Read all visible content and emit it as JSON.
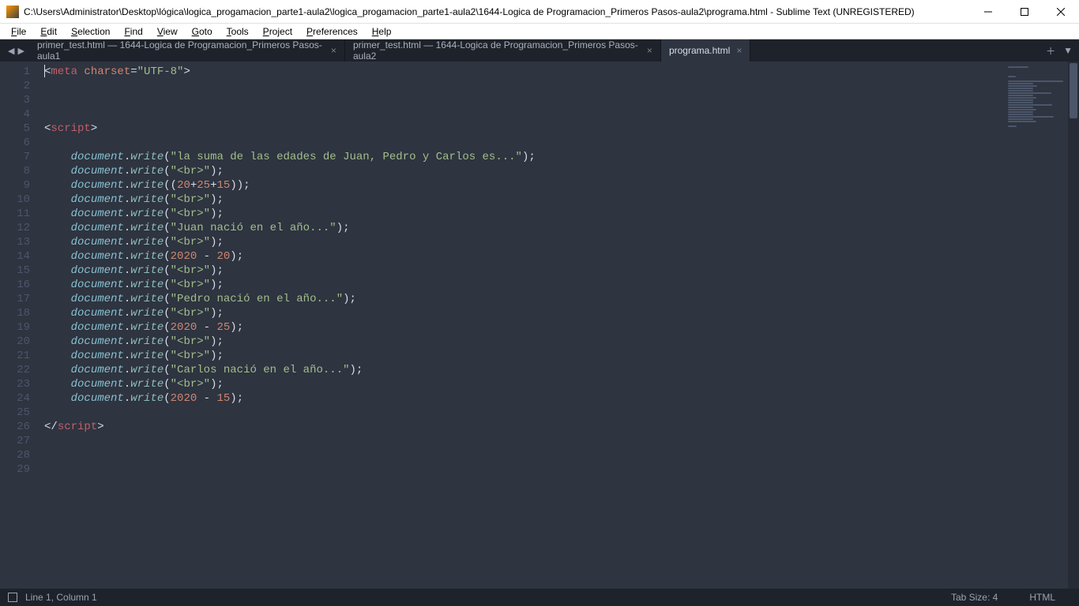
{
  "titlebar": {
    "text": "C:\\Users\\Administrator\\Desktop\\lógica\\logica_progamacion_parte1-aula2\\logica_progamacion_parte1-aula2\\1644-Logica de Programacion_Primeros Pasos-aula2\\programa.html - Sublime Text (UNREGISTERED)"
  },
  "menu": {
    "items": [
      "File",
      "Edit",
      "Selection",
      "Find",
      "View",
      "Goto",
      "Tools",
      "Project",
      "Preferences",
      "Help"
    ]
  },
  "tabs": {
    "items": [
      {
        "label": "primer_test.html — 1644-Logica de Programacion_Primeros Pasos-aula1",
        "active": false
      },
      {
        "label": "primer_test.html — 1644-Logica de Programacion_Primeros Pasos-aula2",
        "active": false
      },
      {
        "label": "programa.html",
        "active": true
      }
    ]
  },
  "code": {
    "lines": [
      {
        "n": 1,
        "tokens": [
          {
            "t": "<",
            "c": "punct"
          },
          {
            "t": "meta",
            "c": "tag"
          },
          {
            "t": " charset",
            "c": "attr"
          },
          {
            "t": "=",
            "c": "punct"
          },
          {
            "t": "\"UTF-8\"",
            "c": "str"
          },
          {
            "t": ">",
            "c": "punct"
          }
        ]
      },
      {
        "n": 2,
        "tokens": []
      },
      {
        "n": 3,
        "tokens": []
      },
      {
        "n": 4,
        "tokens": []
      },
      {
        "n": 5,
        "tokens": [
          {
            "t": "<",
            "c": "punct"
          },
          {
            "t": "script",
            "c": "tag"
          },
          {
            "t": ">",
            "c": "punct"
          }
        ]
      },
      {
        "n": 6,
        "tokens": []
      },
      {
        "n": 7,
        "tokens": [
          {
            "t": "    ",
            "c": "punct"
          },
          {
            "t": "document",
            "c": "ident"
          },
          {
            "t": ".",
            "c": "punct"
          },
          {
            "t": "write",
            "c": "func"
          },
          {
            "t": "(",
            "c": "punct"
          },
          {
            "t": "\"la suma de las edades de Juan, Pedro y Carlos es...\"",
            "c": "str"
          },
          {
            "t": ");",
            "c": "punct"
          }
        ]
      },
      {
        "n": 8,
        "tokens": [
          {
            "t": "    ",
            "c": "punct"
          },
          {
            "t": "document",
            "c": "ident"
          },
          {
            "t": ".",
            "c": "punct"
          },
          {
            "t": "write",
            "c": "func"
          },
          {
            "t": "(",
            "c": "punct"
          },
          {
            "t": "\"<br>\"",
            "c": "str"
          },
          {
            "t": ");",
            "c": "punct"
          }
        ]
      },
      {
        "n": 9,
        "tokens": [
          {
            "t": "    ",
            "c": "punct"
          },
          {
            "t": "document",
            "c": "ident"
          },
          {
            "t": ".",
            "c": "punct"
          },
          {
            "t": "write",
            "c": "func"
          },
          {
            "t": "((",
            "c": "punct"
          },
          {
            "t": "20",
            "c": "num"
          },
          {
            "t": "+",
            "c": "punct"
          },
          {
            "t": "25",
            "c": "num"
          },
          {
            "t": "+",
            "c": "punct"
          },
          {
            "t": "15",
            "c": "num"
          },
          {
            "t": "));",
            "c": "punct"
          }
        ]
      },
      {
        "n": 10,
        "tokens": [
          {
            "t": "    ",
            "c": "punct"
          },
          {
            "t": "document",
            "c": "ident"
          },
          {
            "t": ".",
            "c": "punct"
          },
          {
            "t": "write",
            "c": "func"
          },
          {
            "t": "(",
            "c": "punct"
          },
          {
            "t": "\"<br>\"",
            "c": "str"
          },
          {
            "t": ");",
            "c": "punct"
          }
        ]
      },
      {
        "n": 11,
        "tokens": [
          {
            "t": "    ",
            "c": "punct"
          },
          {
            "t": "document",
            "c": "ident"
          },
          {
            "t": ".",
            "c": "punct"
          },
          {
            "t": "write",
            "c": "func"
          },
          {
            "t": "(",
            "c": "punct"
          },
          {
            "t": "\"<br>\"",
            "c": "str"
          },
          {
            "t": ");",
            "c": "punct"
          }
        ]
      },
      {
        "n": 12,
        "tokens": [
          {
            "t": "    ",
            "c": "punct"
          },
          {
            "t": "document",
            "c": "ident"
          },
          {
            "t": ".",
            "c": "punct"
          },
          {
            "t": "write",
            "c": "func"
          },
          {
            "t": "(",
            "c": "punct"
          },
          {
            "t": "\"Juan nació en el año...\"",
            "c": "str"
          },
          {
            "t": ");",
            "c": "punct"
          }
        ]
      },
      {
        "n": 13,
        "tokens": [
          {
            "t": "    ",
            "c": "punct"
          },
          {
            "t": "document",
            "c": "ident"
          },
          {
            "t": ".",
            "c": "punct"
          },
          {
            "t": "write",
            "c": "func"
          },
          {
            "t": "(",
            "c": "punct"
          },
          {
            "t": "\"<br>\"",
            "c": "str"
          },
          {
            "t": ");",
            "c": "punct"
          }
        ]
      },
      {
        "n": 14,
        "tokens": [
          {
            "t": "    ",
            "c": "punct"
          },
          {
            "t": "document",
            "c": "ident"
          },
          {
            "t": ".",
            "c": "punct"
          },
          {
            "t": "write",
            "c": "func"
          },
          {
            "t": "(",
            "c": "punct"
          },
          {
            "t": "2020",
            "c": "num"
          },
          {
            "t": " - ",
            "c": "punct"
          },
          {
            "t": "20",
            "c": "num"
          },
          {
            "t": ");",
            "c": "punct"
          }
        ]
      },
      {
        "n": 15,
        "tokens": [
          {
            "t": "    ",
            "c": "punct"
          },
          {
            "t": "document",
            "c": "ident"
          },
          {
            "t": ".",
            "c": "punct"
          },
          {
            "t": "write",
            "c": "func"
          },
          {
            "t": "(",
            "c": "punct"
          },
          {
            "t": "\"<br>\"",
            "c": "str"
          },
          {
            "t": ");",
            "c": "punct"
          }
        ]
      },
      {
        "n": 16,
        "tokens": [
          {
            "t": "    ",
            "c": "punct"
          },
          {
            "t": "document",
            "c": "ident"
          },
          {
            "t": ".",
            "c": "punct"
          },
          {
            "t": "write",
            "c": "func"
          },
          {
            "t": "(",
            "c": "punct"
          },
          {
            "t": "\"<br>\"",
            "c": "str"
          },
          {
            "t": ");",
            "c": "punct"
          }
        ]
      },
      {
        "n": 17,
        "tokens": [
          {
            "t": "    ",
            "c": "punct"
          },
          {
            "t": "document",
            "c": "ident"
          },
          {
            "t": ".",
            "c": "punct"
          },
          {
            "t": "write",
            "c": "func"
          },
          {
            "t": "(",
            "c": "punct"
          },
          {
            "t": "\"Pedro nació en el año...\"",
            "c": "str"
          },
          {
            "t": ");",
            "c": "punct"
          }
        ]
      },
      {
        "n": 18,
        "tokens": [
          {
            "t": "    ",
            "c": "punct"
          },
          {
            "t": "document",
            "c": "ident"
          },
          {
            "t": ".",
            "c": "punct"
          },
          {
            "t": "write",
            "c": "func"
          },
          {
            "t": "(",
            "c": "punct"
          },
          {
            "t": "\"<br>\"",
            "c": "str"
          },
          {
            "t": ");",
            "c": "punct"
          }
        ]
      },
      {
        "n": 19,
        "tokens": [
          {
            "t": "    ",
            "c": "punct"
          },
          {
            "t": "document",
            "c": "ident"
          },
          {
            "t": ".",
            "c": "punct"
          },
          {
            "t": "write",
            "c": "func"
          },
          {
            "t": "(",
            "c": "punct"
          },
          {
            "t": "2020",
            "c": "num"
          },
          {
            "t": " - ",
            "c": "punct"
          },
          {
            "t": "25",
            "c": "num"
          },
          {
            "t": ");",
            "c": "punct"
          }
        ]
      },
      {
        "n": 20,
        "tokens": [
          {
            "t": "    ",
            "c": "punct"
          },
          {
            "t": "document",
            "c": "ident"
          },
          {
            "t": ".",
            "c": "punct"
          },
          {
            "t": "write",
            "c": "func"
          },
          {
            "t": "(",
            "c": "punct"
          },
          {
            "t": "\"<br>\"",
            "c": "str"
          },
          {
            "t": ");",
            "c": "punct"
          }
        ]
      },
      {
        "n": 21,
        "tokens": [
          {
            "t": "    ",
            "c": "punct"
          },
          {
            "t": "document",
            "c": "ident"
          },
          {
            "t": ".",
            "c": "punct"
          },
          {
            "t": "write",
            "c": "func"
          },
          {
            "t": "(",
            "c": "punct"
          },
          {
            "t": "\"<br>\"",
            "c": "str"
          },
          {
            "t": ");",
            "c": "punct"
          }
        ]
      },
      {
        "n": 22,
        "tokens": [
          {
            "t": "    ",
            "c": "punct"
          },
          {
            "t": "document",
            "c": "ident"
          },
          {
            "t": ".",
            "c": "punct"
          },
          {
            "t": "write",
            "c": "func"
          },
          {
            "t": "(",
            "c": "punct"
          },
          {
            "t": "\"Carlos nació en el año...\"",
            "c": "str"
          },
          {
            "t": ");",
            "c": "punct"
          }
        ]
      },
      {
        "n": 23,
        "tokens": [
          {
            "t": "    ",
            "c": "punct"
          },
          {
            "t": "document",
            "c": "ident"
          },
          {
            "t": ".",
            "c": "punct"
          },
          {
            "t": "write",
            "c": "func"
          },
          {
            "t": "(",
            "c": "punct"
          },
          {
            "t": "\"<br>\"",
            "c": "str"
          },
          {
            "t": ");",
            "c": "punct"
          }
        ]
      },
      {
        "n": 24,
        "tokens": [
          {
            "t": "    ",
            "c": "punct"
          },
          {
            "t": "document",
            "c": "ident"
          },
          {
            "t": ".",
            "c": "punct"
          },
          {
            "t": "write",
            "c": "func"
          },
          {
            "t": "(",
            "c": "punct"
          },
          {
            "t": "2020",
            "c": "num"
          },
          {
            "t": " - ",
            "c": "punct"
          },
          {
            "t": "15",
            "c": "num"
          },
          {
            "t": ");",
            "c": "punct"
          }
        ]
      },
      {
        "n": 25,
        "tokens": []
      },
      {
        "n": 26,
        "tokens": [
          {
            "t": "</",
            "c": "punct"
          },
          {
            "t": "script",
            "c": "tag"
          },
          {
            "t": ">",
            "c": "punct"
          }
        ]
      },
      {
        "n": 27,
        "tokens": []
      },
      {
        "n": 28,
        "tokens": []
      },
      {
        "n": 29,
        "tokens": []
      }
    ]
  },
  "status": {
    "left": "Line 1, Column 1",
    "tabsize": "Tab Size: 4",
    "syntax": "HTML"
  }
}
